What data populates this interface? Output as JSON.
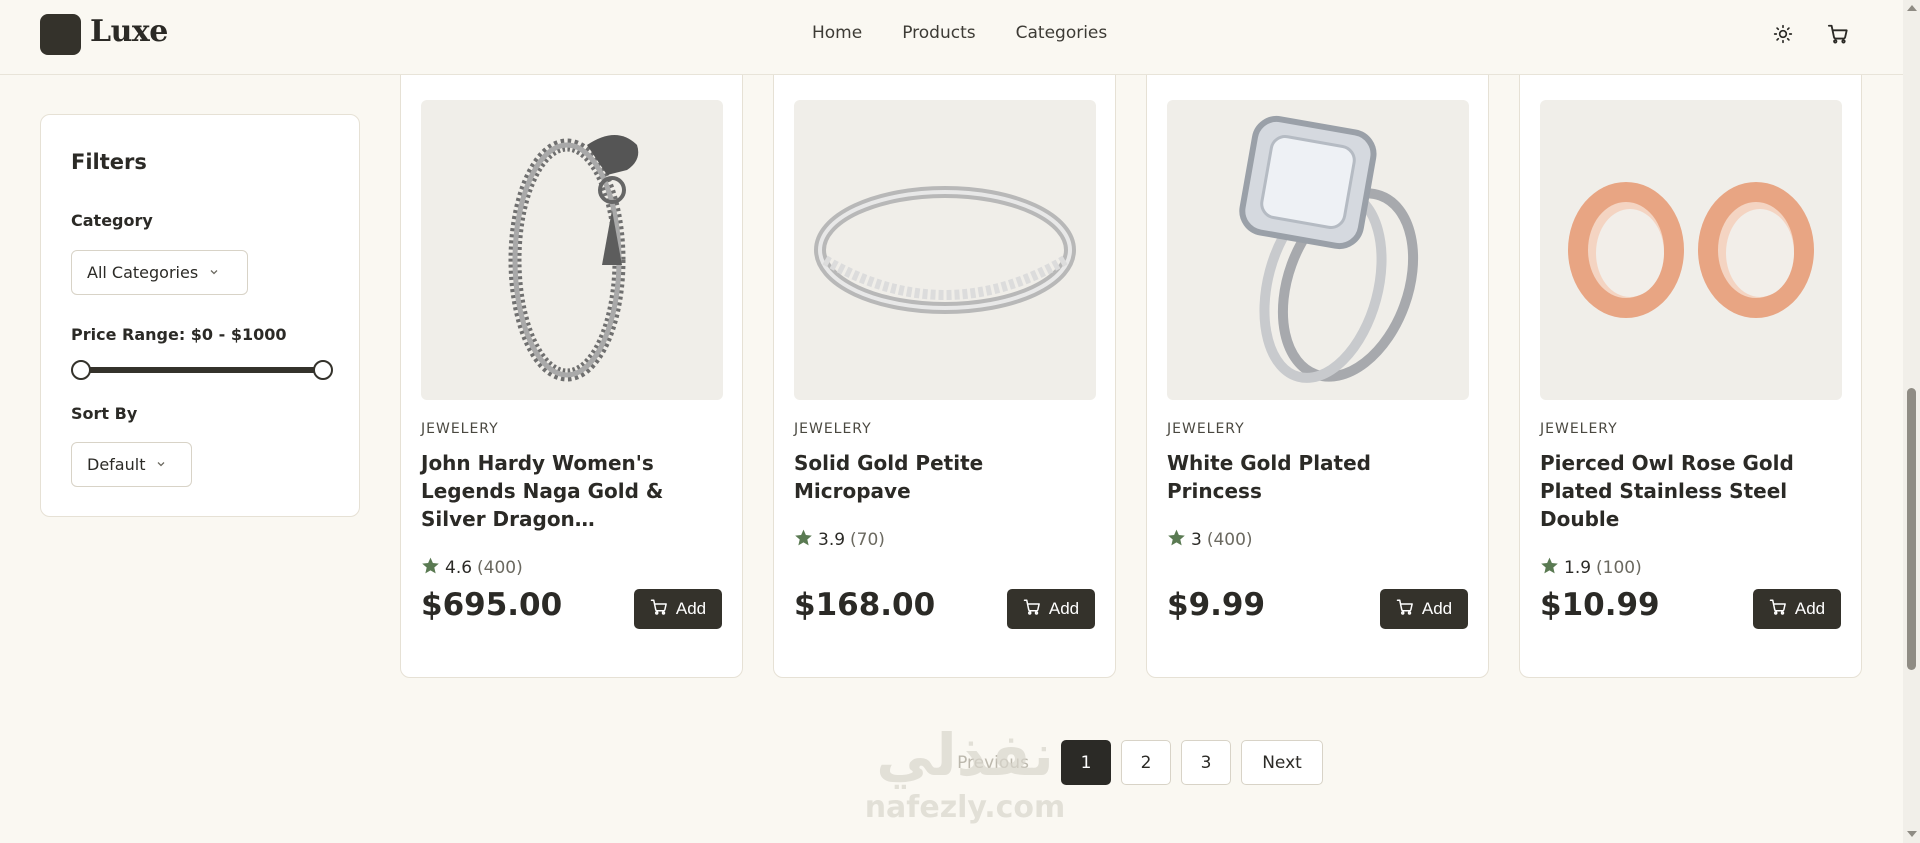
{
  "header": {
    "logo_text": "Luxe",
    "nav": [
      "Home",
      "Products",
      "Categories"
    ]
  },
  "filters": {
    "title": "Filters",
    "category_label": "Category",
    "category_value": "All Categories",
    "price_label": "Price Range: $0 - $1000",
    "price_min": 0,
    "price_max": 1000,
    "sort_label": "Sort By",
    "sort_value": "Default"
  },
  "products": [
    {
      "category": "JEWELERY",
      "name": "John Hardy Women's Legends Naga Gold & Silver Dragon…",
      "rating": "4.6",
      "count": "(400)",
      "price": "$695.00",
      "add": "Add",
      "image": "chain-bracelet"
    },
    {
      "category": "JEWELERY",
      "name": "Solid Gold Petite Micropave",
      "rating": "3.9",
      "count": "(70)",
      "price": "$168.00",
      "add": "Add",
      "image": "band-ring"
    },
    {
      "category": "JEWELERY",
      "name": "White Gold Plated Princess",
      "rating": "3",
      "count": "(400)",
      "price": "$9.99",
      "add": "Add",
      "image": "diamond-ring"
    },
    {
      "category": "JEWELERY",
      "name": "Pierced Owl Rose Gold Plated Stainless Steel Double",
      "rating": "1.9",
      "count": "(100)",
      "price": "$10.99",
      "add": "Add",
      "image": "rose-gold-tunnels"
    }
  ],
  "pagination": {
    "previous": "Previous",
    "pages": [
      "1",
      "2",
      "3"
    ],
    "current": "1",
    "next": "Next"
  },
  "watermark": {
    "arabic": "نفذلي",
    "latin": "nafezly.com"
  },
  "colors": {
    "accent": "#34322b",
    "background": "#faf8f2",
    "star": "#5a7a52"
  }
}
